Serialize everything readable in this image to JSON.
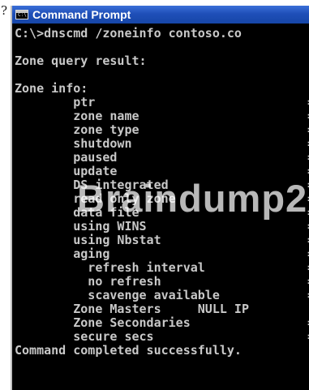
{
  "prefix_mark": "?",
  "window": {
    "title": "Command Prompt",
    "icon_label": "C:\\"
  },
  "console": {
    "lines": [
      "C:\\>dnscmd /zoneinfo contoso.co",
      "",
      "Zone query result:",
      "",
      "Zone info:",
      "        ptr",
      "        zone name",
      "        zone type",
      "        shutdown",
      "        paused",
      "        update",
      "        DS integrated",
      "        read only zone",
      "        data file",
      "        using WINS",
      "        using Nbstat",
      "        aging",
      "          refresh interval",
      "          no refresh",
      "          scavenge available",
      "        Zone Masters     NULL IP",
      "        Zone Secondaries",
      "        secure secs",
      "Command completed successfully."
    ],
    "equals_mark": "="
  },
  "watermark": "Braindump2",
  "colors": {
    "titlebar": "#1f4fb8",
    "console_bg": "#000000",
    "console_text": "#c8c8c8"
  }
}
